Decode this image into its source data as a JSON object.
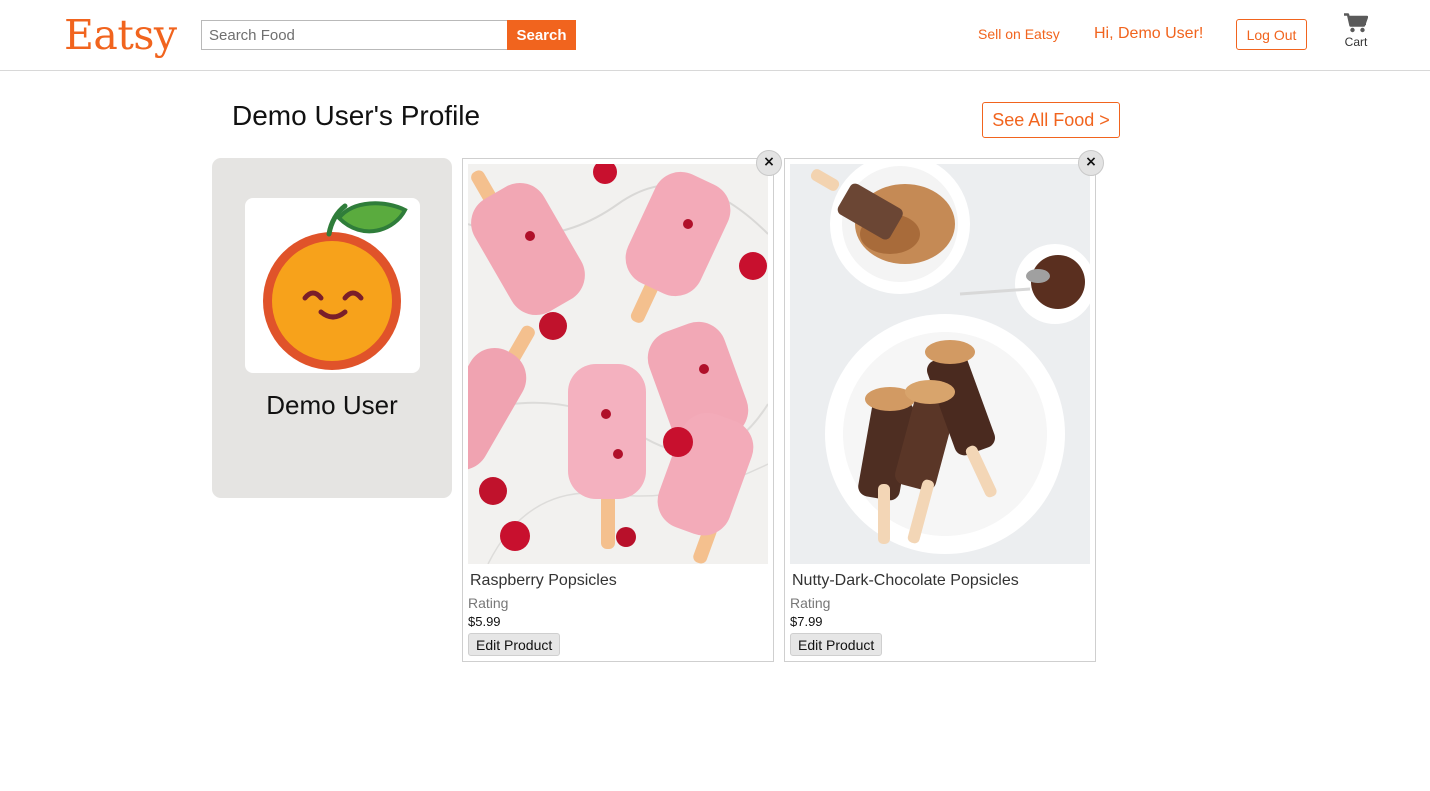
{
  "header": {
    "logo": "Eatsy",
    "search_placeholder": "Search Food",
    "search_button": "Search",
    "sell_link": "Sell on Eatsy",
    "greeting": "Hi, Demo User!",
    "logout": "Log Out",
    "cart_label": "Cart",
    "cart_icon": "cart-icon"
  },
  "profile": {
    "title": "Demo User's Profile",
    "see_all": "See All Food >",
    "name": "Demo User",
    "avatar_icon": "smiling-orange-avatar"
  },
  "products": [
    {
      "name": "Raspberry Popsicles",
      "rating_label": "Rating",
      "price": "$5.99",
      "edit_label": "Edit Product",
      "remove_label": "×"
    },
    {
      "name": "Nutty-Dark-Chocolate Popsicles",
      "rating_label": "Rating",
      "price": "$7.99",
      "edit_label": "Edit Product",
      "remove_label": "×"
    }
  ],
  "colors": {
    "brand": "#f1641e",
    "profile_card_bg": "#e5e4e2"
  }
}
